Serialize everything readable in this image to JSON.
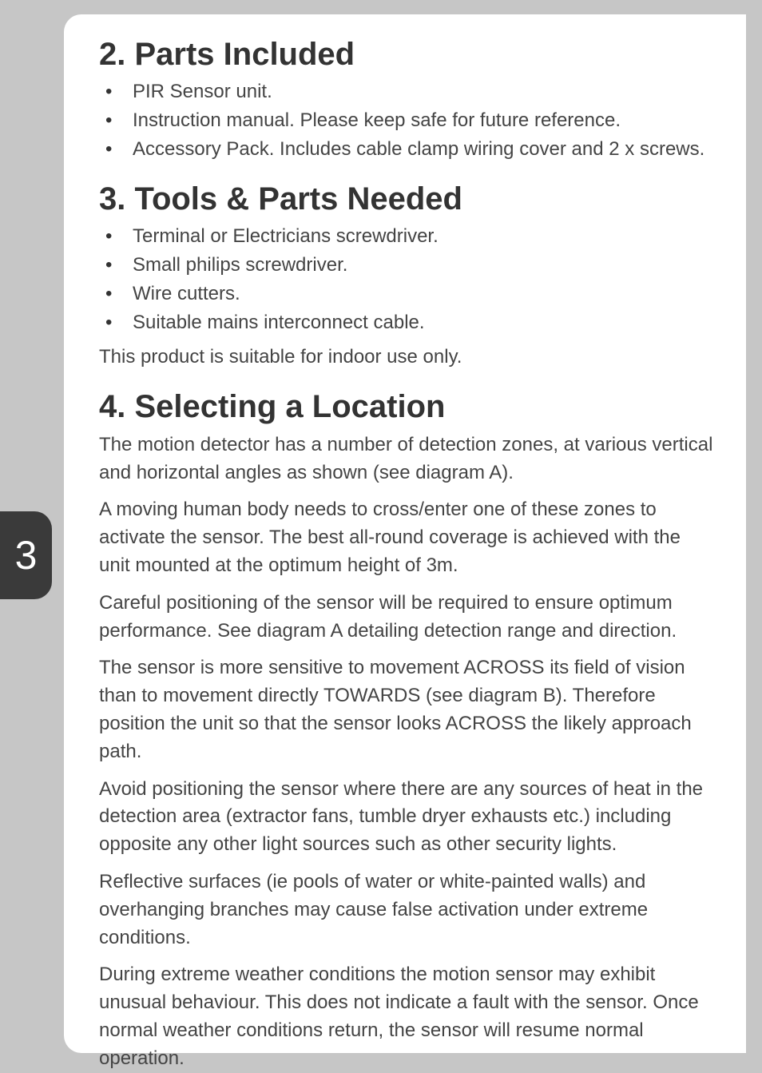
{
  "page_number": "3",
  "sections": {
    "parts_included": {
      "heading": "2. Parts Included",
      "items": [
        "PIR Sensor unit.",
        "Instruction manual. Please keep safe for future reference.",
        "Accessory Pack. Includes cable clamp wiring cover and 2 x screws."
      ]
    },
    "tools_needed": {
      "heading": "3. Tools & Parts Needed",
      "items": [
        "Terminal or Electricians screwdriver.",
        "Small philips screwdriver.",
        "Wire cutters.",
        "Suitable mains interconnect cable."
      ],
      "note": "This product is suitable for indoor use only."
    },
    "selecting_location": {
      "heading": "4. Selecting a Location",
      "paragraphs": [
        "The motion detector has a number of detection zones, at various vertical and horizontal angles as shown (see diagram A).",
        "A moving human body needs to cross/enter one of these zones to activate the sensor. The best all-round coverage is achieved with the unit mounted at the optimum height of 3m.",
        "Careful positioning of the sensor will be required to ensure optimum performance. See diagram A detailing detection range and direction.",
        "The sensor is more sensitive to movement ACROSS its field of vision than to movement directly TOWARDS (see diagram B). Therefore position the unit so that the sensor looks ACROSS the likely approach path.",
        "Avoid positioning the sensor where there are any sources of heat in the detection area (extractor fans, tumble dryer exhausts etc.) including opposite any other light sources such as other security lights.",
        "Reflective surfaces (ie pools of water or white-painted walls) and overhanging branches may cause false activation under extreme conditions.",
        "During extreme weather conditions the motion sensor may exhibit unusual behaviour. This does not indicate a fault with the sensor. Once normal weather conditions return, the sensor will resume normal operation."
      ]
    }
  }
}
